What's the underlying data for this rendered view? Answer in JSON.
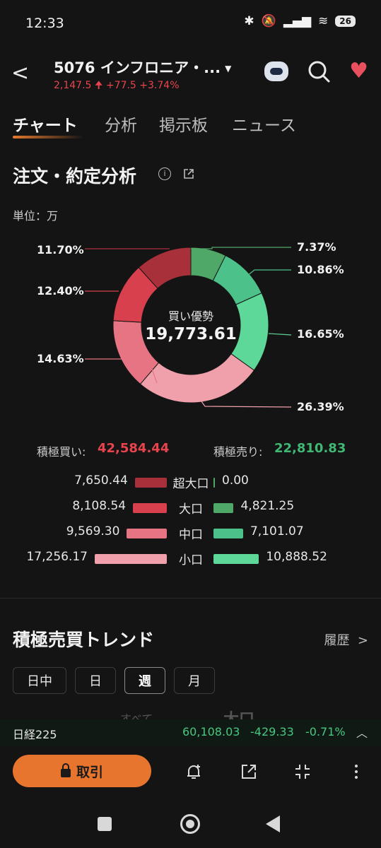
{
  "status_bar": {
    "time": "12:33",
    "battery": "26"
  },
  "header": {
    "title": "5076 インフロニア・...",
    "price": "2,147.5",
    "change": "+77.5",
    "change_pct": "+3.74%"
  },
  "tabs": [
    "チャート",
    "分析",
    "掲示板",
    "ニュース"
  ],
  "section": {
    "title": "注文・約定分析",
    "unit": "単位：万"
  },
  "chart_data": {
    "type": "pie",
    "center_label": "買い優勢",
    "center_value": "19,773.61",
    "slices": [
      {
        "label": "超大口 売り",
        "value": 7.37,
        "pct_text": "7.37%",
        "color": "#4fa868"
      },
      {
        "label": "大口 売り",
        "value": 10.86,
        "pct_text": "10.86%",
        "color": "#4cc28a"
      },
      {
        "label": "中口 売り",
        "value": 16.65,
        "pct_text": "16.65%",
        "color": "#5ed898"
      },
      {
        "label": "小口 買い",
        "value": 26.39,
        "pct_text": "26.39%",
        "color": "#f0a0aa"
      },
      {
        "label": "中口 買い",
        "value": 14.63,
        "pct_text": "14.63%",
        "color": "#e77482"
      },
      {
        "label": "大口 買い",
        "value": 12.4,
        "pct_text": "12.40%",
        "color": "#d8404e"
      },
      {
        "label": "超大口 買い",
        "value": 11.7,
        "pct_text": "11.70%",
        "color": "#a8303a"
      }
    ]
  },
  "totals": {
    "buy_label": "積極買い:",
    "buy_value": "42,584.44",
    "sell_label": "積極売り:",
    "sell_value": "22,810.83"
  },
  "breakdown": [
    {
      "size": "超大口",
      "buy": "7,650.44",
      "sell": "0.00",
      "buy_num": 7650.44,
      "sell_num": 0.0,
      "buy_color": "#a8303a",
      "sell_color": "#4fa868"
    },
    {
      "size": "大口",
      "buy": "8,108.54",
      "sell": "4,821.25",
      "buy_num": 8108.54,
      "sell_num": 4821.25,
      "buy_color": "#d8404e",
      "sell_color": "#4fa868"
    },
    {
      "size": "中口",
      "buy": "9,569.30",
      "sell": "7,101.07",
      "buy_num": 9569.3,
      "sell_num": 7101.07,
      "buy_color": "#e77482",
      "sell_color": "#4cc28a"
    },
    {
      "size": "小口",
      "buy": "17,256.17",
      "sell": "10,888.52",
      "buy_num": 17256.17,
      "sell_num": 10888.52,
      "buy_color": "#f0a0aa",
      "sell_color": "#5ed898"
    }
  ],
  "trend": {
    "title": "積極売買トレンド",
    "history": "履歴"
  },
  "period_tabs": [
    "日中",
    "日",
    "週",
    "月"
  ],
  "ghost_text": {
    "all": "すべて",
    "large": "大口"
  },
  "ticker": {
    "name": "日経225",
    "price": "60,108.03",
    "change": "-429.33",
    "pct": "-0.71%"
  },
  "bottom": {
    "trade_label": "取引"
  }
}
